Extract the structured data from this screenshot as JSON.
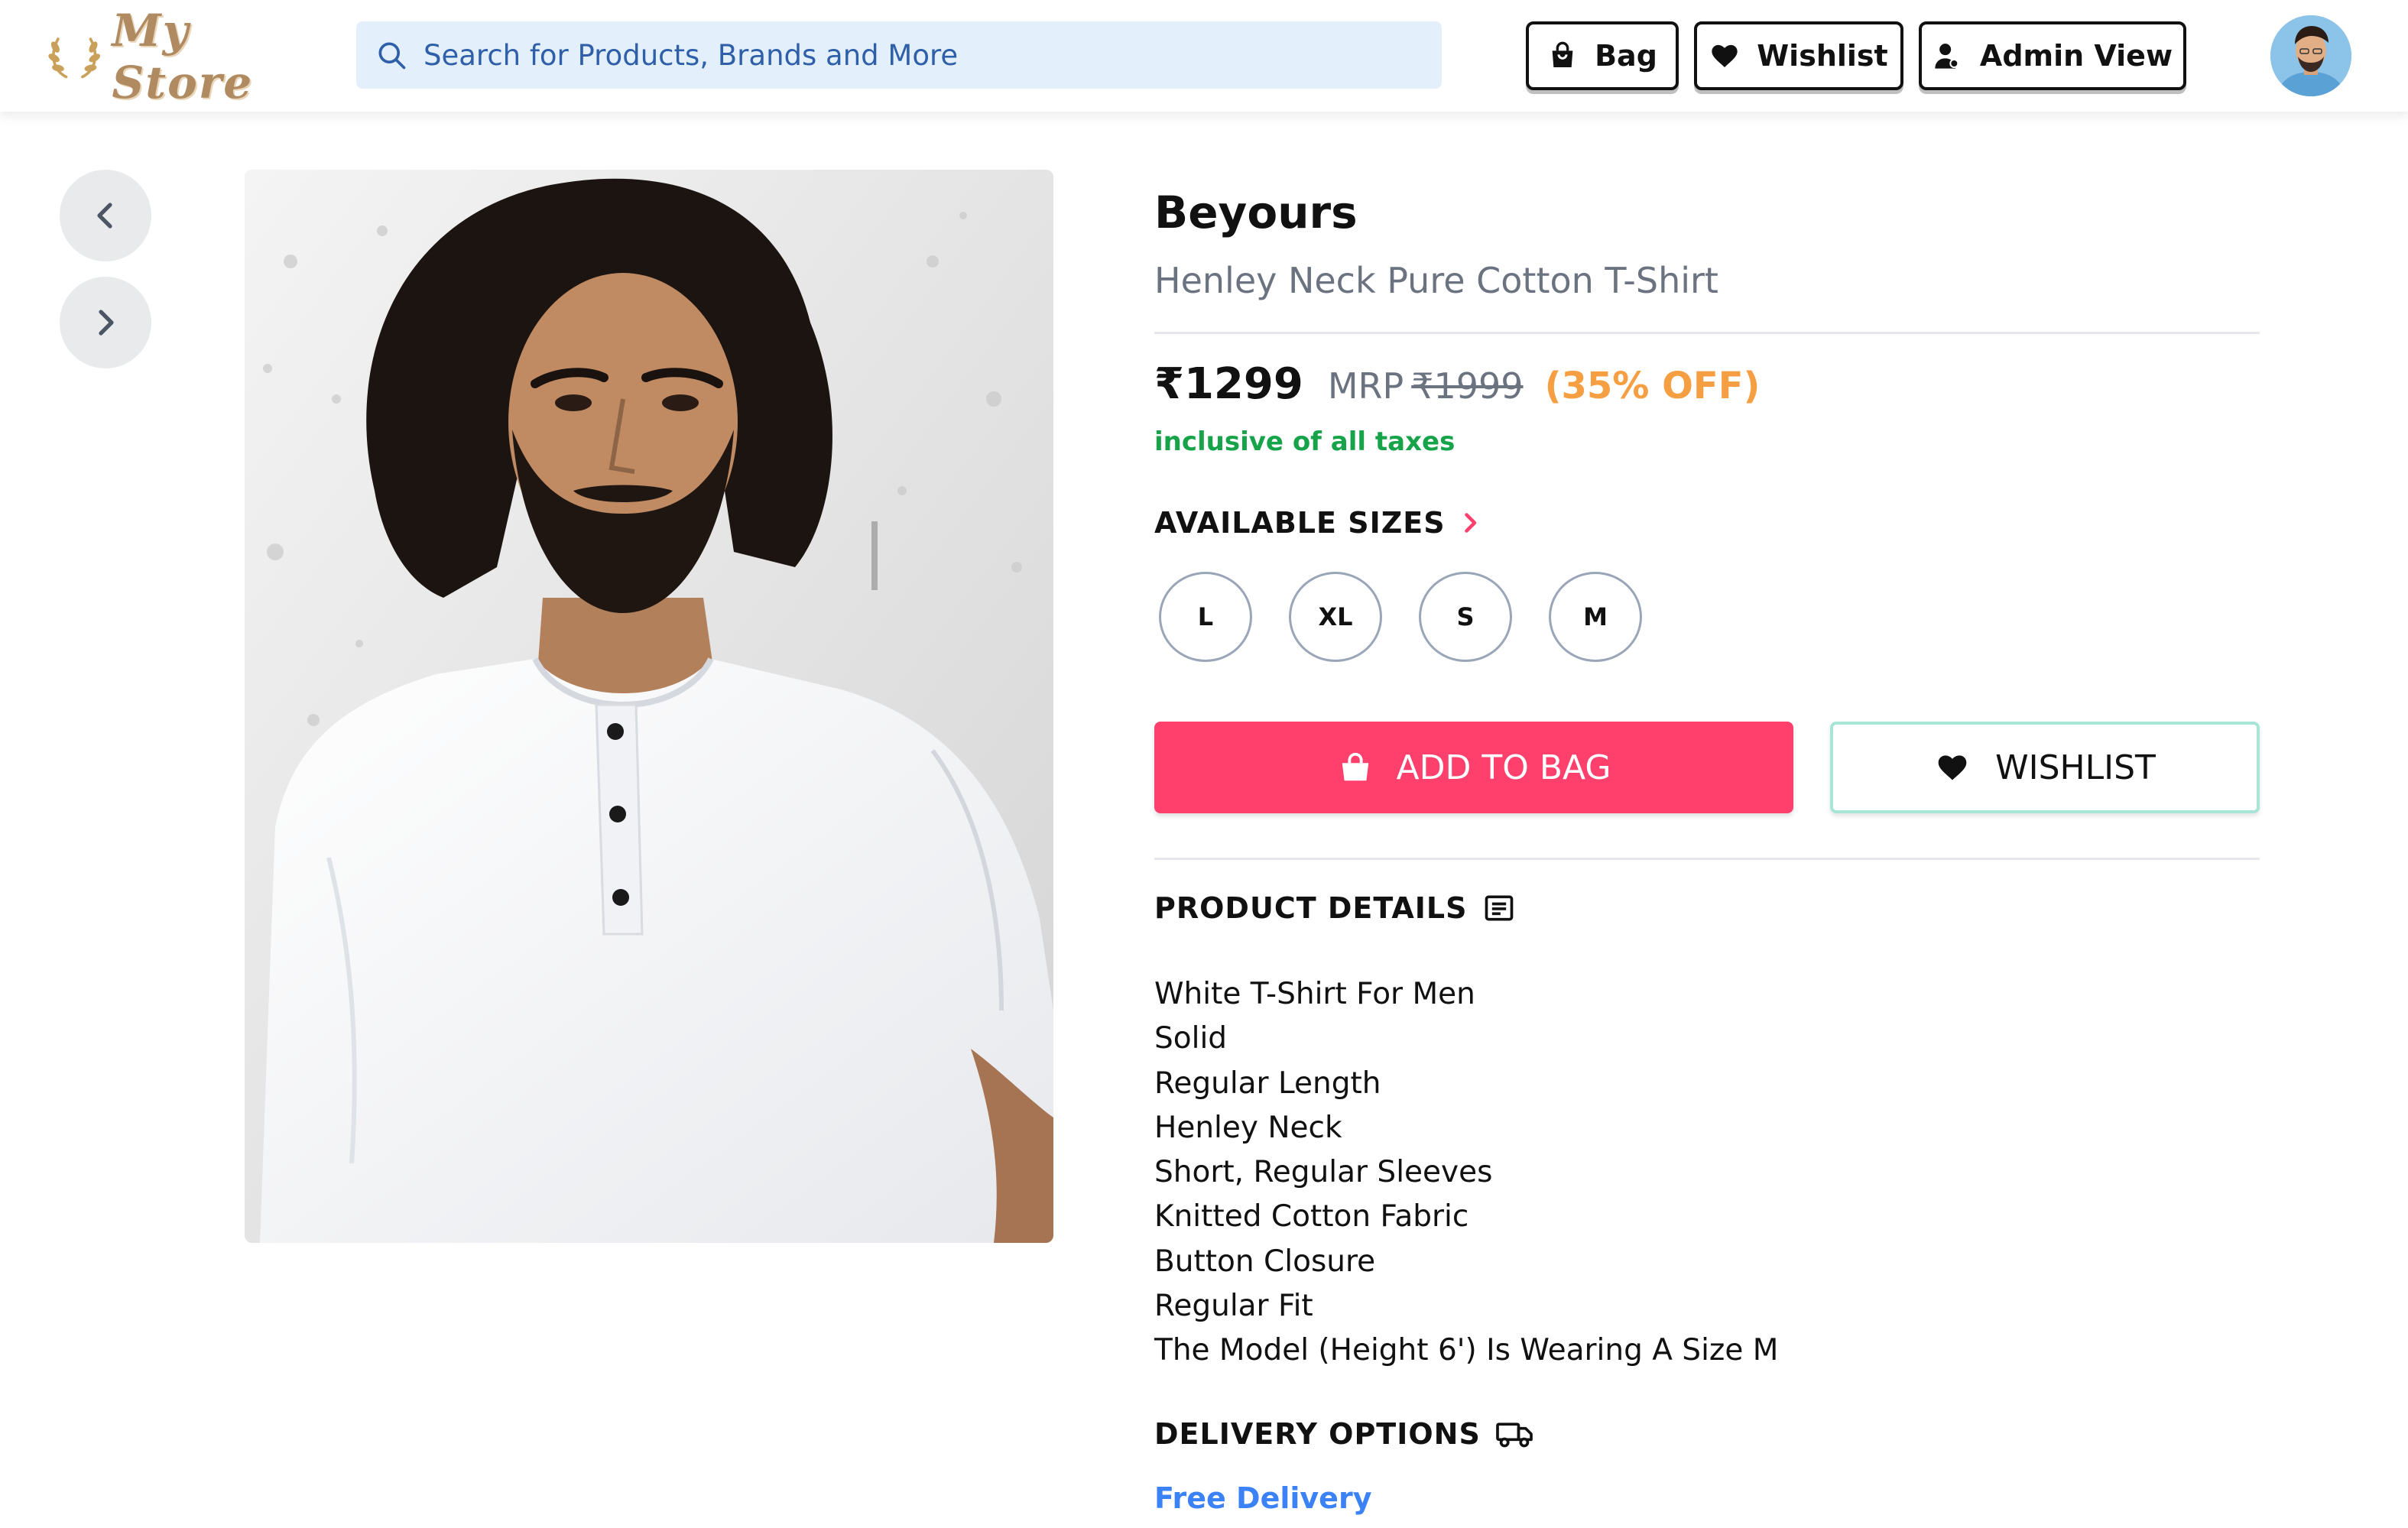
{
  "header": {
    "logo_text": "My Store",
    "search_placeholder": "Search for Products, Brands and More",
    "buttons": {
      "bag": "Bag",
      "wishlist": "Wishlist",
      "admin": "Admin View"
    }
  },
  "product": {
    "brand": "Beyours",
    "name": "Henley Neck Pure Cotton T-Shirt",
    "price": "₹1299",
    "mrp_label": "MRP",
    "mrp_value": "₹1999",
    "discount": "(35% OFF)",
    "tax_note": "inclusive of all taxes",
    "sizes_title": "AVAILABLE SIZES",
    "sizes": [
      "L",
      "XL",
      "S",
      "M"
    ],
    "add_to_bag": "ADD TO BAG",
    "wishlist": "WISHLIST",
    "details_title": "PRODUCT DETAILS",
    "details": [
      "White T-Shirt For Men",
      "Solid",
      "Regular Length",
      "Henley Neck",
      "Short, Regular Sleeves",
      "Knitted Cotton Fabric",
      "Button Closure",
      "Regular Fit",
      "The Model (Height 6') Is Wearing A Size M"
    ],
    "delivery_title": "DELIVERY OPTIONS",
    "delivery": "Free Delivery"
  },
  "colors": {
    "accent": "#ff3f6c",
    "discount": "#f59e42",
    "tax_note": "#16a34a",
    "delivery": "#3b82f6",
    "search_bg": "#e3f0fc"
  },
  "icons": {
    "search": "search-icon",
    "bag": "shopping-bag-icon",
    "wishlist": "heart-icon",
    "admin": "user-icon",
    "prev": "chevron-left-icon",
    "next": "chevron-right-icon",
    "sizes": "chevron-right-icon",
    "details": "document-icon",
    "delivery": "truck-icon"
  }
}
